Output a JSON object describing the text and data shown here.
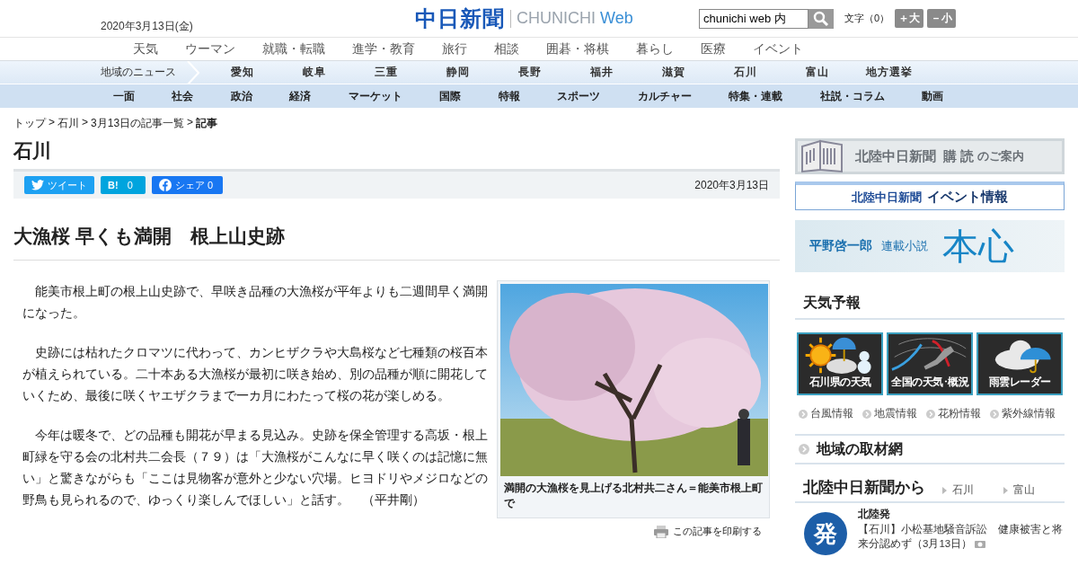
{
  "header": {
    "date": "2020年3月13日(金)",
    "logo_main": "中日新聞",
    "logo_sub": "CHUNICHI",
    "logo_web": "Web",
    "search": {
      "value": "chunichi web 内"
    },
    "font_size": {
      "label": "文字（0）",
      "larger": "＋大",
      "smaller": "－小"
    }
  },
  "nav_primary": [
    "天気",
    "ウーマン",
    "就職・転職",
    "進学・教育",
    "旅行",
    "相談",
    "囲碁・将棋",
    "暮らし",
    "医療",
    "イベント"
  ],
  "region_nav": {
    "label": "地域のニュース",
    "items": [
      "愛知",
      "岐阜",
      "三重",
      "静岡",
      "長野",
      "福井",
      "滋賀",
      "石川",
      "富山",
      "地方選挙"
    ]
  },
  "category_nav": [
    "一面",
    "社会",
    "政治",
    "経済",
    "マーケット",
    "国際",
    "特報",
    "スポーツ",
    "カルチャー",
    "特集・連載",
    "社説・コラム",
    "動画"
  ],
  "breadcrumb": [
    {
      "kind": "link",
      "label": "トップ"
    },
    {
      "kind": "sep",
      "label": ">"
    },
    {
      "kind": "link",
      "label": "石川"
    },
    {
      "kind": "sep",
      "label": ">"
    },
    {
      "kind": "link",
      "label": "3月13日の記事一覧"
    },
    {
      "kind": "sep",
      "label": ">"
    },
    {
      "kind": "current",
      "label": "記事"
    }
  ],
  "section_title": "石川",
  "share": [
    {
      "kind": "twitter",
      "label": "ツイート"
    },
    {
      "kind": "hatena",
      "label": "B!",
      "count": "0"
    },
    {
      "kind": "facebook",
      "label": "シェア",
      "count": "0"
    }
  ],
  "article_date": "2020年3月13日",
  "headline": "大漁桜 早くも満開　根上山史跡",
  "paragraphs": [
    "能美市根上町の根上山史跡で、早咲き品種の大漁桜が平年よりも二週間早く満開になった。",
    "史跡には枯れたクロマツに代わって、カンヒザクラや大島桜など七種類の桜百本が植えられている。二十本ある大漁桜が最初に咲き始め、別の品種が順に開花していくため、最後に咲くヤエザクラまで一カ月にわたって桜の花が楽しめる。",
    "今年は暖冬で、どの品種も開花が早まる見込み。史跡を保全管理する高坂・根上町緑を守る会の北村共二会長（７９）は「大漁桜がこんなに早く咲くのは記憶に無い」と驚きながらも「ここは見物客が意外と少ない穴場。ヒヨドリやメジロなどの野鳥も見られるので、ゆっくり楽しんでほしい」と話す。　（平井剛）"
  ],
  "photo_caption": "満開の大漁桜を見上げる北村共二さん＝能美市根上町で",
  "print_label": "この記事を印刷する",
  "sidebar": {
    "subscribe_banner": {
      "title": "北陸中日新聞",
      "accent": "購 読",
      "suffix": "のご案内"
    },
    "event_banner": {
      "title": "北陸中日新聞",
      "accent": "イベント情報"
    },
    "novel_banner": {
      "author": "平野啓一郎",
      "label": "連載小説",
      "title": "本心"
    },
    "weather": {
      "title": "天気予報",
      "tiles": [
        {
          "kind": "local",
          "label": "石川県の天気"
        },
        {
          "kind": "national",
          "label": "全国の天気･概況"
        },
        {
          "kind": "radar",
          "label": "雨雲レーダー"
        }
      ],
      "links": [
        "台風情報",
        "地震情報",
        "花粉情報",
        "紫外線情報"
      ]
    },
    "local_network": "地域の取材網",
    "hokuriku": {
      "title": "北陸中日新聞から",
      "tabs": [
        "石川",
        "富山"
      ],
      "badge": "発",
      "kicker": "北陸発",
      "text": "【石川】小松基地騒音訴訟　健康被害と将来分認めず（3月13日）"
    }
  }
}
